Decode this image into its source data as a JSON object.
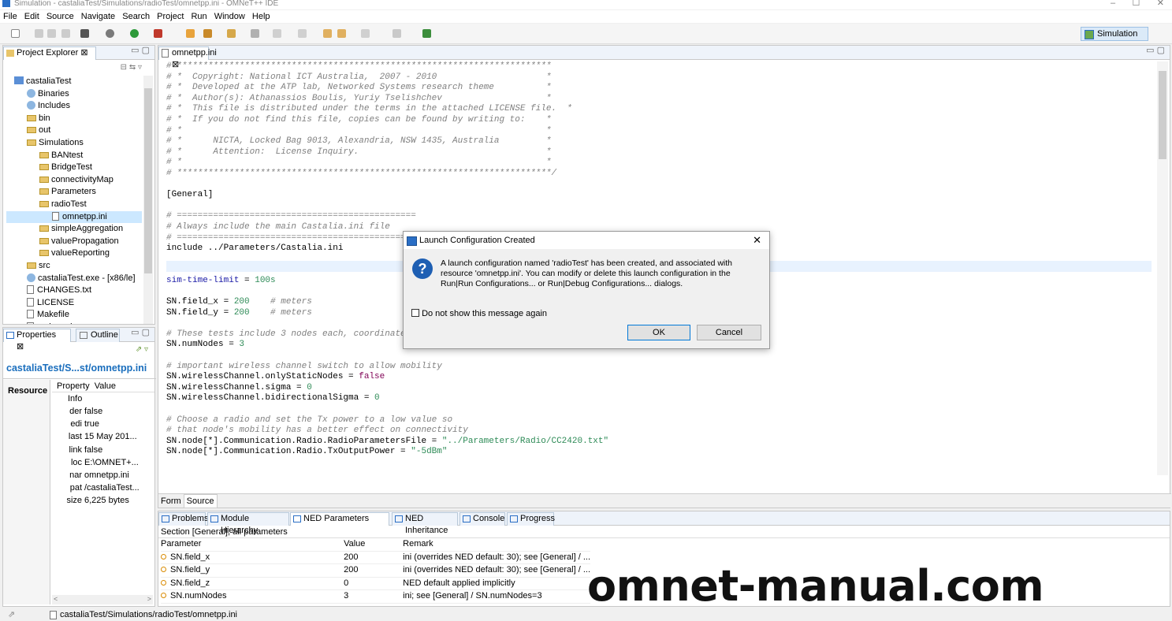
{
  "window": {
    "title": "Simulation - castaliaTest/Simulations/radioTest/omnetpp.ini - OMNeT++ IDE",
    "controls": [
      "–",
      "☐",
      "✕"
    ]
  },
  "menu": [
    "File",
    "Edit",
    "Source",
    "Navigate",
    "Search",
    "Project",
    "Run",
    "Window",
    "Help"
  ],
  "perspective": {
    "label": "Simulation"
  },
  "project_explorer": {
    "tab": "Project Explorer",
    "items": [
      {
        "label": "castaliaTest",
        "kind": "project",
        "indent": 0
      },
      {
        "label": "Binaries",
        "kind": "bin",
        "indent": 1
      },
      {
        "label": "Includes",
        "kind": "bin",
        "indent": 1
      },
      {
        "label": "bin",
        "kind": "folder",
        "indent": 1
      },
      {
        "label": "out",
        "kind": "folder",
        "indent": 1
      },
      {
        "label": "Simulations",
        "kind": "folder",
        "indent": 1
      },
      {
        "label": "BANtest",
        "kind": "folder",
        "indent": 2
      },
      {
        "label": "BridgeTest",
        "kind": "folder",
        "indent": 2
      },
      {
        "label": "connectivityMap",
        "kind": "folder",
        "indent": 2
      },
      {
        "label": "Parameters",
        "kind": "folder",
        "indent": 2
      },
      {
        "label": "radioTest",
        "kind": "folder",
        "indent": 2
      },
      {
        "label": "omnetpp.ini",
        "kind": "file",
        "indent": 3
      },
      {
        "label": "simpleAggregation",
        "kind": "folder",
        "indent": 2
      },
      {
        "label": "valuePropagation",
        "kind": "folder",
        "indent": 2
      },
      {
        "label": "valueReporting",
        "kind": "folder",
        "indent": 2
      },
      {
        "label": "src",
        "kind": "folder",
        "indent": 1
      },
      {
        "label": "castaliaTest.exe - [x86/le]",
        "kind": "bin",
        "indent": 1
      },
      {
        "label": "CHANGES.txt",
        "kind": "file",
        "indent": 1
      },
      {
        "label": "LICENSE",
        "kind": "file",
        "indent": 1
      },
      {
        "label": "Makefile",
        "kind": "file",
        "indent": 1
      },
      {
        "label": "makemake",
        "kind": "file",
        "indent": 1
      }
    ]
  },
  "properties": {
    "tab": "Properties",
    "tab2": "Outline",
    "title": "castaliaTest/S...st/omnetpp.ini",
    "side_tab": "Resource",
    "col_property": "Property",
    "col_value": "Value",
    "section": "Info",
    "rows": [
      {
        "k": "der",
        "v": "false"
      },
      {
        "k": "edi",
        "v": "true"
      },
      {
        "k": "last",
        "v": "15 May 201..."
      },
      {
        "k": "link",
        "v": "false"
      },
      {
        "k": "loc",
        "v": "E:\\OMNET+..."
      },
      {
        "k": "nar",
        "v": "omnetpp.ini"
      },
      {
        "k": "pat",
        "v": "/castaliaTest..."
      },
      {
        "k": "size",
        "v": "6,225  bytes"
      }
    ]
  },
  "editor": {
    "tab": "omnetpp.ini",
    "bottom_tabs": [
      "Form",
      "Source"
    ]
  },
  "dialog": {
    "title": "Launch Configuration Created",
    "message": "A launch configuration named 'radioTest' has been created, and associated with resource 'omnetpp.ini'. You can modify or delete this launch configuration in the Run|Run Configurations... or Run|Debug Configurations... dialogs.",
    "checkbox": "Do not show this message again",
    "ok": "OK",
    "cancel": "Cancel"
  },
  "bottom_panel": {
    "tabs": [
      "Problems",
      "Module Hierarchy",
      "NED Parameters",
      "NED Inheritance",
      "Console",
      "Progress"
    ],
    "section": "Section [General], all parameters",
    "columns": [
      "Parameter",
      "Value",
      "Remark"
    ],
    "rows": [
      {
        "param": "SN.field_x",
        "value": "200",
        "remark": "ini (overrides NED default: 30); see [General] / ..."
      },
      {
        "param": "SN.field_y",
        "value": "200",
        "remark": "ini (overrides NED default: 30); see [General] / ..."
      },
      {
        "param": "SN.field_z",
        "value": "0",
        "remark": "NED default applied implicitly"
      },
      {
        "param": "SN.numNodes",
        "value": "3",
        "remark": "ini; see [General] / SN.numNodes=3"
      }
    ]
  },
  "status": {
    "path": "castaliaTest/Simulations/radioTest/omnetpp.ini"
  },
  "watermark": "omnet-manual.com"
}
